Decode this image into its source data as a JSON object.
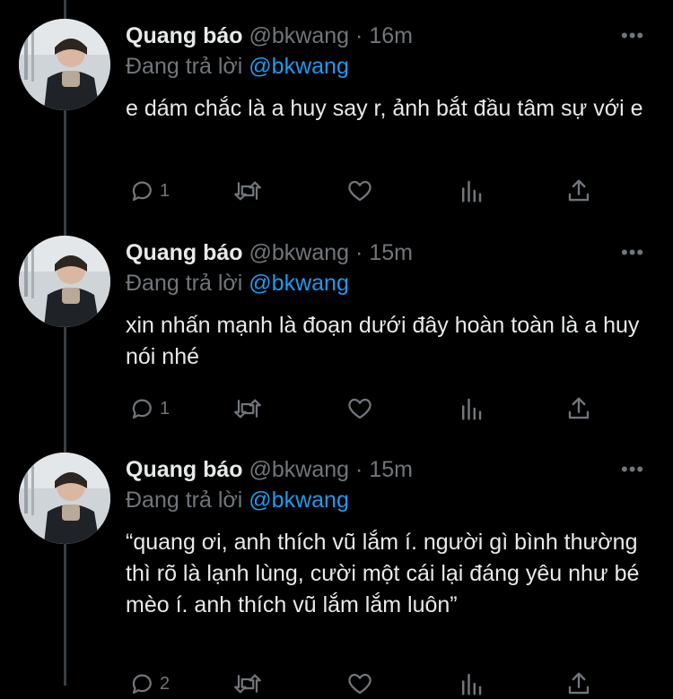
{
  "thread": {
    "tweets": [
      {
        "name": "Quang báo",
        "handle": "@bkwang",
        "sep": "·",
        "time": "16m",
        "reply_prefix": "Đang trả lời",
        "reply_to": "@bkwang",
        "text": "e dám chắc là a huy say r, ảnh bắt đầu tâm sự với e",
        "reply_count": "1",
        "more": "•••"
      },
      {
        "name": "Quang báo",
        "handle": "@bkwang",
        "sep": "·",
        "time": "15m",
        "reply_prefix": "Đang trả lời",
        "reply_to": "@bkwang",
        "text": "xin nhấn mạnh là đoạn dưới đây hoàn toàn là a huy nói nhé",
        "reply_count": "1",
        "more": "•••"
      },
      {
        "name": "Quang báo",
        "handle": "@bkwang",
        "sep": "·",
        "time": "15m",
        "reply_prefix": "Đang trả lời",
        "reply_to": "@bkwang",
        "text": "“quang ơi, anh thích vũ lắm í. người gì bình thường thì rõ là lạnh lùng, cười một cái lại đáng yêu như bé mèo í. anh thích vũ lắm lắm luôn”",
        "reply_count": "2",
        "more": "•••"
      }
    ]
  },
  "icons": {
    "reply": "reply-icon",
    "retweet": "retweet-icon",
    "like": "heart-icon",
    "analytics": "analytics-icon",
    "share": "share-icon",
    "more": "more-icon"
  },
  "colors": {
    "background": "#000000",
    "text": "#e7e9ea",
    "muted": "#71767b",
    "link": "#1d9bf0",
    "thread_line": "#3a3f44"
  }
}
